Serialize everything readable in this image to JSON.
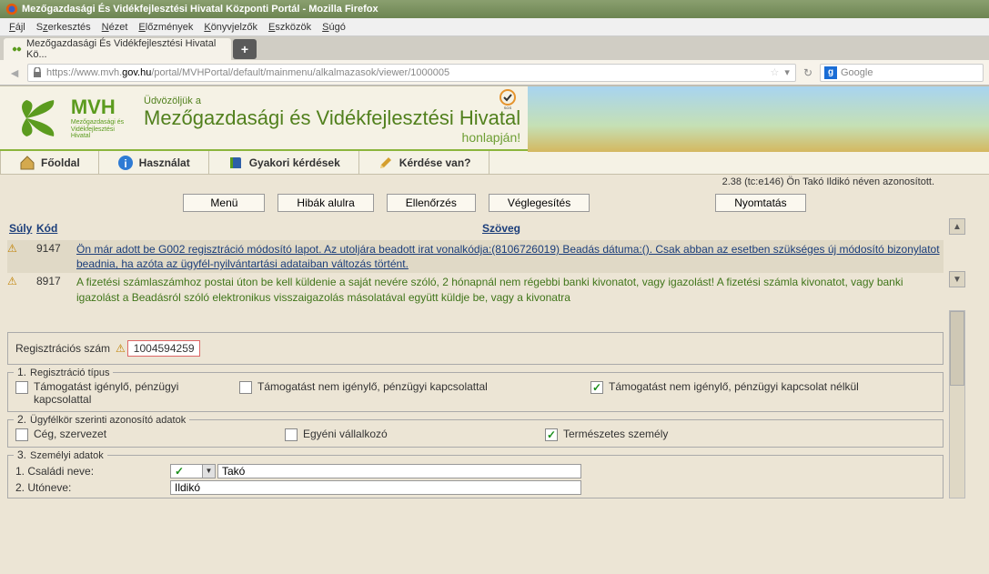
{
  "browser": {
    "title": "Mezőgazdasági És Vidékfejlesztési Hivatal Központi Portál - Mozilla Firefox",
    "menu": [
      "Fájl",
      "Szerkesztés",
      "Nézet",
      "Előzmények",
      "Könyvjelzők",
      "Eszközök",
      "Súgó"
    ],
    "tab_title": "Mezőgazdasági És Vidékfejlesztési Hivatal Kö...",
    "url_prefix": "https://www.mvh.",
    "url_domain": "gov.hu",
    "url_path": "/portal/MVHPortal/default/mainmenu/alkalmazasok/viewer/1000005",
    "search_placeholder": "Google"
  },
  "header": {
    "logo_main": "MVH",
    "logo_sub1": "Mezőgazdasági és",
    "logo_sub2": "Vidékfejlesztési",
    "logo_sub3": "Hivatal",
    "welcome_small": "Üdvözöljük a",
    "welcome_big": "Mezőgazdasági és Vidékfejlesztési Hivatal",
    "welcome_sub": "honlapján!"
  },
  "nav": {
    "home": "Főoldal",
    "usage": "Használat",
    "faq": "Gyakori kérdések",
    "question": "Kérdése van?"
  },
  "status_line": "2.38 (tc:e146) Ön Takó Ildikó néven azonosított.",
  "toolbar": {
    "menu": "Menü",
    "errors": "Hibák alulra",
    "check": "Ellenőrzés",
    "finalize": "Véglegesítés",
    "print": "Nyomtatás"
  },
  "messages": {
    "col_suly": "Súly",
    "col_kod": "Kód",
    "col_szoveg": "Szöveg",
    "rows": [
      {
        "code": "9147",
        "text": "Ön már adott be G002 regisztráció módosító lapot. Az utoljára beadott irat vonalkódja:(8106726019) Beadás dátuma:(). Csak abban az esetben szükséges új módosító bizonylatot beadnia, ha azóta az ügyfél-nyilvántartási adataiban változás történt.",
        "link": true
      },
      {
        "code": "8917",
        "text": "A fizetési számlaszámhoz postai úton be kell küldenie a saját nevére szóló, 2 hónapnál nem régebbi banki kivonatot, vagy igazolást! A fizetési számla kivonatot, vagy banki igazolást a Beadásról szóló elektronikus visszaigazolás másolatával együtt küldje be, vagy a kivonatra",
        "link": false
      }
    ]
  },
  "form": {
    "reg_label": "Regisztrációs szám",
    "reg_value": "1004594259",
    "section1": {
      "num": "1.",
      "legend": "Regisztráció típus",
      "opt1": "Támogatást igénylő, pénzügyi kapcsolattal",
      "opt2": "Támogatást nem igénylő, pénzügyi kapcsolattal",
      "opt3": "Támogatást nem igénylő, pénzügyi kapcsolat nélkül"
    },
    "section2": {
      "num": "2.",
      "legend": "Ügyfélkör szerinti azonosító adatok",
      "opt1": "Cég, szervezet",
      "opt2": "Egyéni vállalkozó",
      "opt3": "Természetes személy"
    },
    "section3": {
      "num": "3.",
      "legend": "Személyi adatok",
      "family_label": "1. Családi neve:",
      "family_value": "Takó",
      "first_label": "2. Utóneve:",
      "first_value": "Ildikó"
    }
  }
}
